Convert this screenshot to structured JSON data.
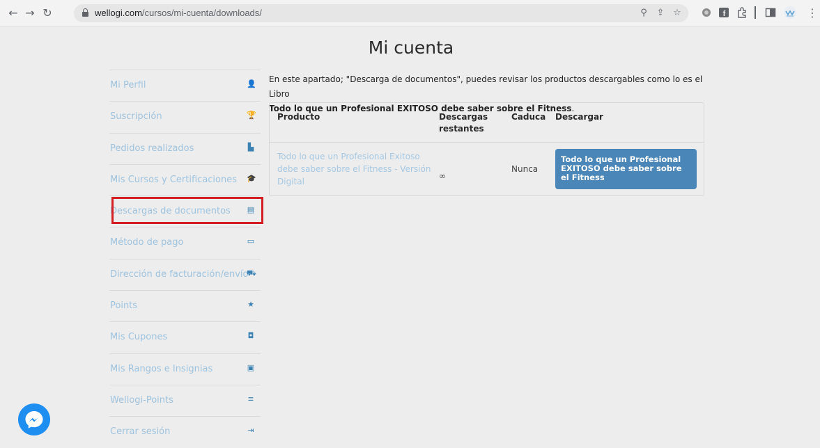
{
  "browser": {
    "url_host": "wellogi.com",
    "url_path": "/cursos/mi-cuenta/downloads/"
  },
  "page": {
    "title": "Mi cuenta"
  },
  "sidebar": {
    "items": [
      {
        "label": "Mi Perfil",
        "icon": "user-icon"
      },
      {
        "label": "Suscripción",
        "icon": "trophy-icon"
      },
      {
        "label": "Pedidos realizados",
        "icon": "orders-icon"
      },
      {
        "label": "Mis Cursos y Certificaciones",
        "icon": "graduation-icon"
      },
      {
        "label": "Descargas de documentos",
        "icon": "document-icon"
      },
      {
        "label": "Método de pago",
        "icon": "credit-card-icon"
      },
      {
        "label": "Dirección de facturación/envío",
        "icon": "truck-icon"
      },
      {
        "label": "Points",
        "icon": "star-icon"
      },
      {
        "label": "Mis Cupones",
        "icon": "coupon-icon"
      },
      {
        "label": "Mis Rangos e Insignias",
        "icon": "badge-icon"
      },
      {
        "label": "Wellogi-Points",
        "icon": "points-icon"
      },
      {
        "label": "Cerrar sesión",
        "icon": "logout-icon"
      }
    ]
  },
  "intro": {
    "text": "En este apartado; \"Descarga de documentos\", puedes revisar los productos descargables como lo es el Libro",
    "bold": "Todo lo que un Profesional EXITOSO debe saber sobre el Fitness",
    "end": "."
  },
  "table": {
    "headers": {
      "product": "Producto",
      "remaining": "Descargas restantes",
      "expires": "Caduca",
      "download": "Descargar"
    },
    "row": {
      "product": "Todo lo que un Profesional Exitoso debe saber sobre el Fitness - Versión Digital",
      "remaining": "∞",
      "expires": "Nunca",
      "download_label": "Todo lo que un Profesional EXITOSO debe saber sobre el Fitness"
    }
  },
  "colors": {
    "accent": "#4a86b8",
    "link": "#9ec3df",
    "highlight": "#d21f24"
  }
}
